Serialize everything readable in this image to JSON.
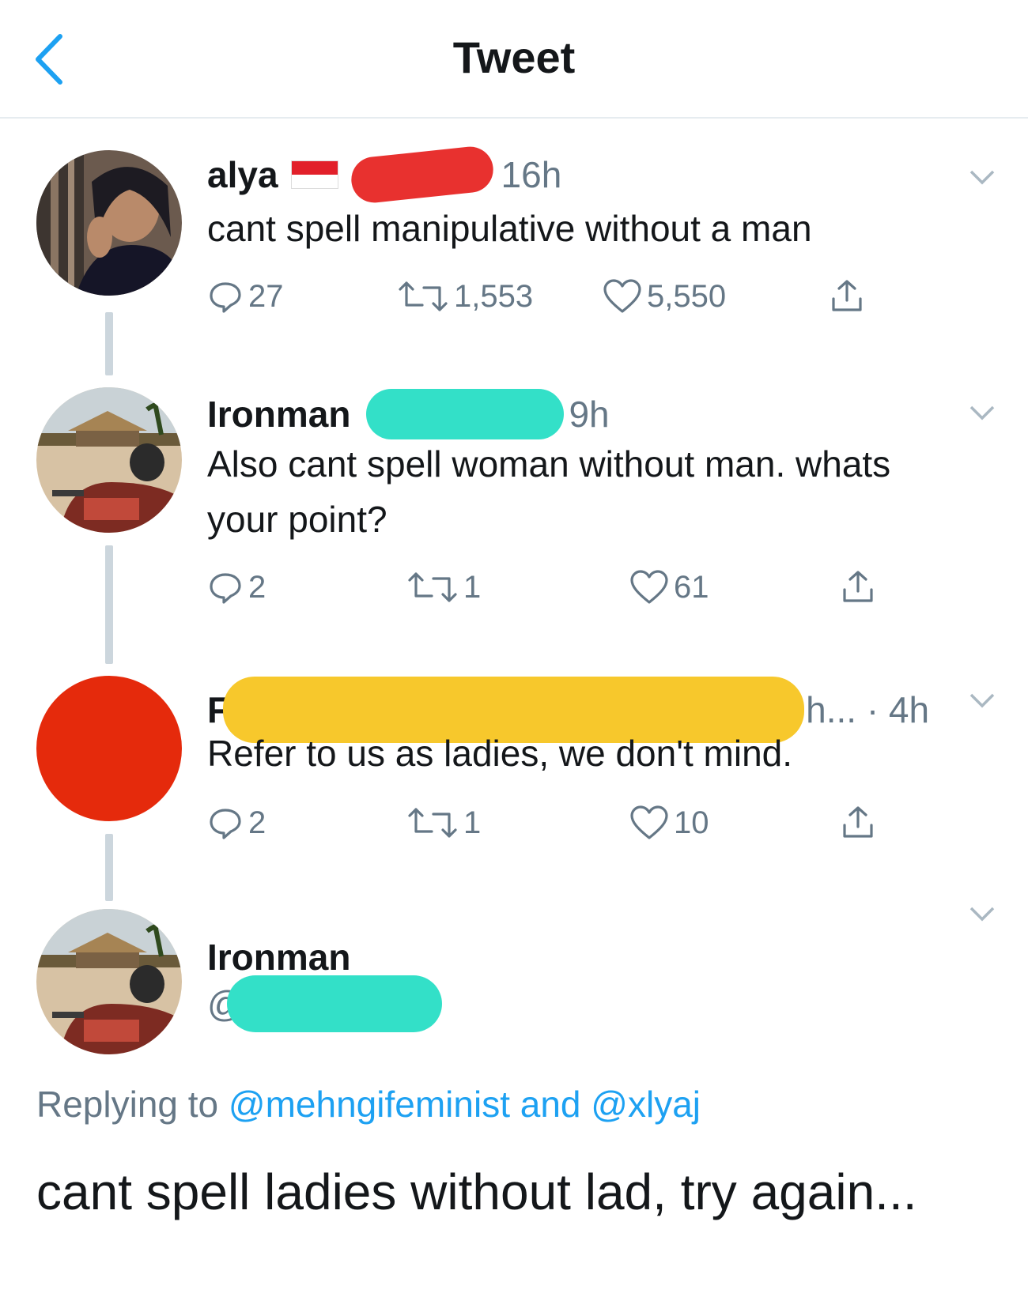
{
  "header": {
    "title": "Tweet"
  },
  "tweets": [
    {
      "name": "alya",
      "time": "16h",
      "text": "cant spell manipulative without a man",
      "replies": "27",
      "retweets": "1,553",
      "likes": "5,550"
    },
    {
      "name": "Ironman",
      "time": "9h",
      "text": "Also cant spell woman without man. whats your point?",
      "replies": "2",
      "retweets": "1",
      "likes": "61"
    },
    {
      "name_visible": "F",
      "time": "h... · 4h",
      "text": "Refer to us as ladies, we don't mind.",
      "replies": "2",
      "retweets": "1",
      "likes": "10"
    }
  ],
  "main_tweet": {
    "name": "Ironman",
    "handle_prefix": "@",
    "replying_prefix": "Replying to",
    "mention_1": "@mehngifeminist",
    "and": "and",
    "mention_2": "@xlyaj",
    "text": "cant spell ladies without lad, try again..."
  },
  "colors": {
    "link": "#1da1f2",
    "muted": "#657786",
    "redact_red": "#e8312f",
    "redact_teal": "#33e0c8",
    "redact_yellow": "#f7c82c",
    "avatar_red": "#e52a0c"
  }
}
